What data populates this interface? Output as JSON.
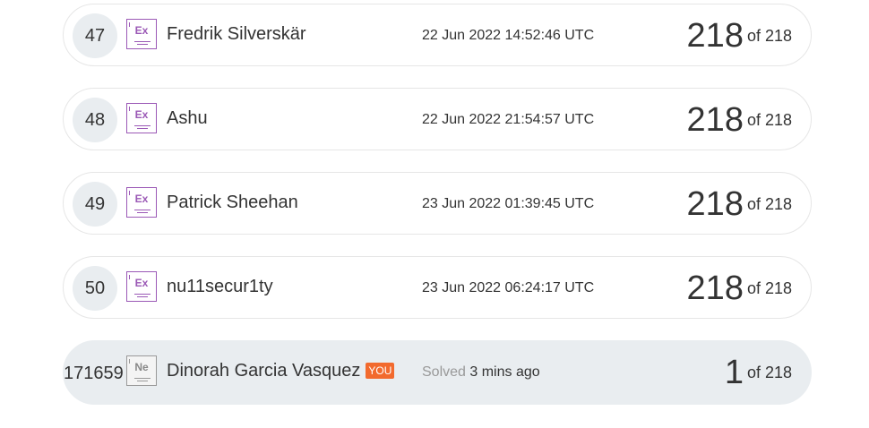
{
  "leaderboard": {
    "rows": [
      {
        "rank": "47",
        "badge": "Ex",
        "name": "Fredrik Silverskär",
        "date": "22 Jun 2022 14:52:46 UTC",
        "score": "218",
        "of": "of 218"
      },
      {
        "rank": "48",
        "badge": "Ex",
        "name": "Ashu",
        "date": "22 Jun 2022 21:54:57 UTC",
        "score": "218",
        "of": "of 218"
      },
      {
        "rank": "49",
        "badge": "Ex",
        "name": "Patrick Sheehan",
        "date": "23 Jun 2022 01:39:45 UTC",
        "score": "218",
        "of": "of 218"
      },
      {
        "rank": "50",
        "badge": "Ex",
        "name": "nu11secur1ty",
        "date": "23 Jun 2022 06:24:17 UTC",
        "score": "218",
        "of": "of 218"
      }
    ],
    "me": {
      "rank": "171659",
      "badge": "Ne",
      "name": "Dinorah Garcia Vasquez",
      "you": "YOU",
      "solved_label": "Solved",
      "solved_time": "3 mins ago",
      "score": "1",
      "of": "of 218"
    }
  },
  "colors": {
    "expert_badge": "#9b59b6",
    "novice_badge": "#999999",
    "you_tag": "#f26a2e",
    "rank_bg": "#e9edf0"
  }
}
